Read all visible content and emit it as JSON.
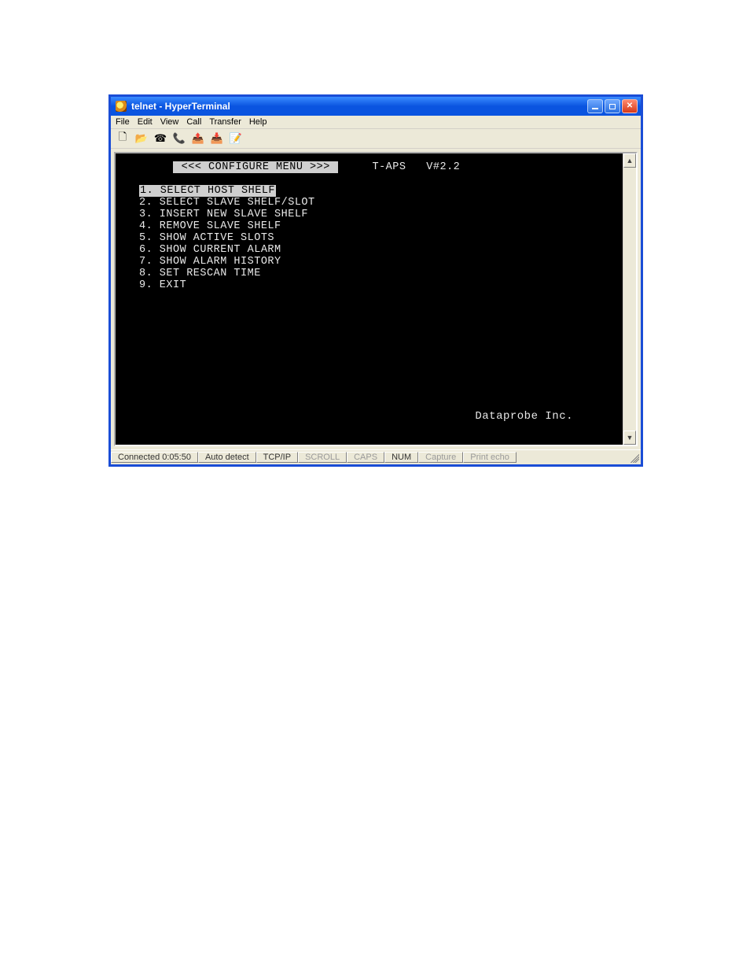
{
  "window": {
    "title": "telnet - HyperTerminal"
  },
  "menubar": {
    "items": [
      "File",
      "Edit",
      "View",
      "Call",
      "Transfer",
      "Help"
    ]
  },
  "toolbar": {
    "icons": [
      {
        "name": "new-file-icon",
        "glyph": "🗋"
      },
      {
        "name": "open-file-icon",
        "glyph": "📂"
      },
      {
        "name": "connect-icon",
        "glyph": "☎"
      },
      {
        "name": "disconnect-icon",
        "glyph": "📞"
      },
      {
        "name": "send-icon",
        "glyph": "📤"
      },
      {
        "name": "receive-icon",
        "glyph": "📥"
      },
      {
        "name": "properties-icon",
        "glyph": "📝"
      }
    ]
  },
  "terminal": {
    "menu_title": " <<< CONFIGURE MENU >>> ",
    "right_label": "T-APS   V#2.2",
    "items": [
      {
        "num": "1.",
        "text": "SELECT HOST SHELF",
        "selected": true
      },
      {
        "num": "2.",
        "text": "SELECT SLAVE SHELF/SLOT",
        "selected": false
      },
      {
        "num": "3.",
        "text": "INSERT NEW SLAVE SHELF",
        "selected": false
      },
      {
        "num": "4.",
        "text": "REMOVE SLAVE SHELF",
        "selected": false
      },
      {
        "num": "5.",
        "text": "SHOW ACTIVE SLOTS",
        "selected": false
      },
      {
        "num": "6.",
        "text": "SHOW CURRENT ALARM",
        "selected": false
      },
      {
        "num": "7.",
        "text": "SHOW ALARM HISTORY",
        "selected": false
      },
      {
        "num": "8.",
        "text": "SET RESCAN TIME",
        "selected": false
      },
      {
        "num": "9.",
        "text": "EXIT",
        "selected": false
      }
    ],
    "company": "Dataprobe Inc."
  },
  "statusbar": {
    "connected": "Connected 0:05:50",
    "autodetect": "Auto detect",
    "protocol": "TCP/IP",
    "scroll": "SCROLL",
    "caps": "CAPS",
    "num": "NUM",
    "capture": "Capture",
    "printecho": "Print echo"
  }
}
